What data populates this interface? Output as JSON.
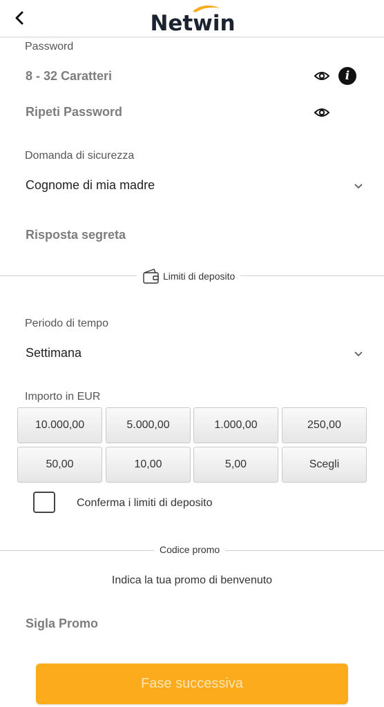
{
  "header": {
    "brand": "Netwin",
    "back_icon": "chevron-left-icon"
  },
  "password": {
    "label": "Password",
    "placeholder": "8 - 32 Caratteri",
    "repeat_placeholder": "Ripeti Password"
  },
  "security": {
    "label": "Domanda di sicurezza",
    "selected": "Cognome di mia madre",
    "answer_placeholder": "Risposta segreta"
  },
  "deposit": {
    "section_title": "Limiti di deposito",
    "period_label": "Periodo di tempo",
    "period_selected": "Settimana",
    "amount_label": "Importo in EUR",
    "amounts": [
      "10.000,00",
      "5.000,00",
      "1.000,00",
      "250,00",
      "50,00",
      "10,00",
      "5,00",
      "Scegli"
    ],
    "confirm_label": "Conferma i limiti di deposito"
  },
  "promo": {
    "section_title": "Codice promo",
    "hint": "Indica la tua promo di benvenuto",
    "placeholder": "Sigla Promo"
  },
  "actions": {
    "next_label": "Fase successiva"
  },
  "colors": {
    "accent": "#fbab1c",
    "brand_dark": "#1b2330"
  }
}
